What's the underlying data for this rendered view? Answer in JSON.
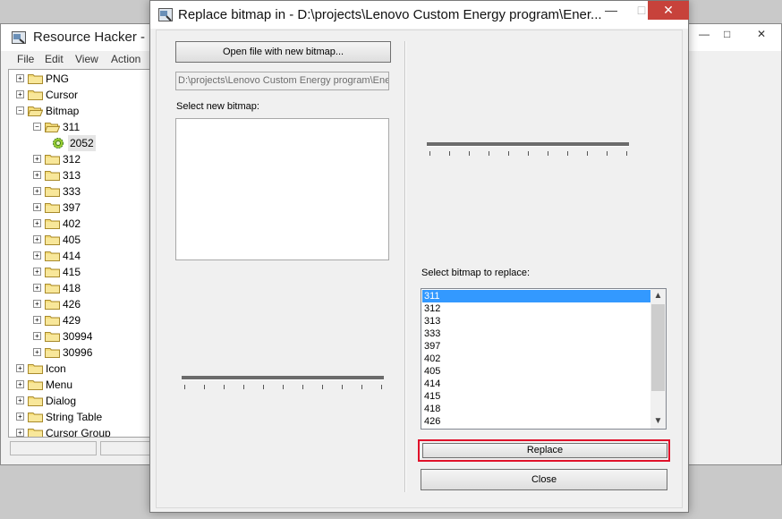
{
  "main_window": {
    "title": "Resource Hacker  -",
    "controls": {
      "minimize": "—",
      "maximize": "□",
      "close": "✕"
    },
    "menu": [
      "File",
      "Edit",
      "View",
      "Action"
    ],
    "tree": [
      {
        "label": "PNG",
        "expander": "+"
      },
      {
        "label": "Cursor",
        "expander": "+"
      },
      {
        "label": "Bitmap",
        "expander": "−"
      },
      {
        "label": "311",
        "expander": "−"
      },
      {
        "label": "2052",
        "expander": ""
      },
      {
        "label": "312",
        "expander": "+"
      },
      {
        "label": "313",
        "expander": "+"
      },
      {
        "label": "333",
        "expander": "+"
      },
      {
        "label": "397",
        "expander": "+"
      },
      {
        "label": "402",
        "expander": "+"
      },
      {
        "label": "405",
        "expander": "+"
      },
      {
        "label": "414",
        "expander": "+"
      },
      {
        "label": "415",
        "expander": "+"
      },
      {
        "label": "418",
        "expander": "+"
      },
      {
        "label": "426",
        "expander": "+"
      },
      {
        "label": "429",
        "expander": "+"
      },
      {
        "label": "30994",
        "expander": "+"
      },
      {
        "label": "30996",
        "expander": "+"
      },
      {
        "label": "Icon",
        "expander": "+"
      },
      {
        "label": "Menu",
        "expander": "+"
      },
      {
        "label": "Dialog",
        "expander": "+"
      },
      {
        "label": "String Table",
        "expander": "+"
      },
      {
        "label": "Cursor Group",
        "expander": "+"
      }
    ]
  },
  "dialog": {
    "title": "Replace bitmap in - D:\\projects\\Lenovo Custom Energy program\\Ener...",
    "controls": {
      "minimize": "—",
      "maximize": "□",
      "close": "✕"
    },
    "open_button": "Open file with new bitmap...",
    "file_path": "D:\\projects\\Lenovo Custom Energy program\\Ener",
    "select_new_label": "Select new bitmap:",
    "select_replace_label": "Select bitmap to replace:",
    "bitmap_list": [
      "311",
      "312",
      "313",
      "333",
      "397",
      "402",
      "405",
      "414",
      "415",
      "418",
      "426"
    ],
    "selected_bitmap": "311",
    "replace_button": "Replace",
    "close_button": "Close",
    "scroll_up": "▲",
    "scroll_down": "▼"
  },
  "colors": {
    "selection": "#3399ff",
    "highlight_border": "#e0112a",
    "close_button": "#c7423b"
  }
}
